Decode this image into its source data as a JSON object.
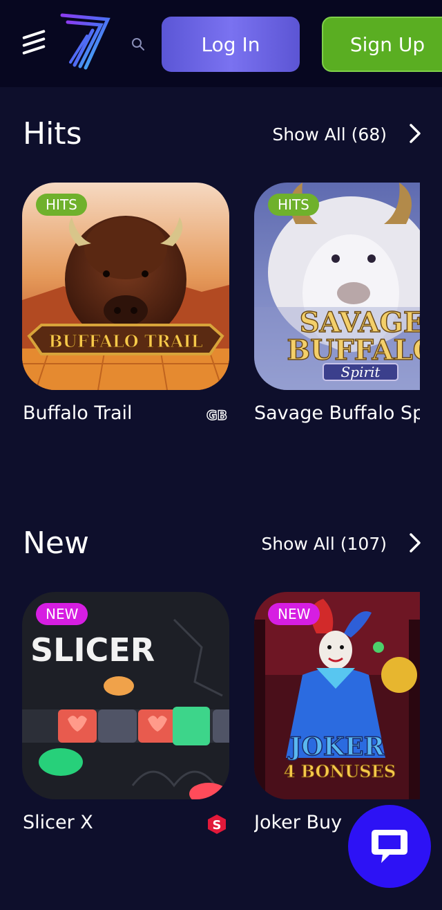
{
  "header": {
    "login_label": "Log In",
    "signup_label": "Sign Up",
    "icons": [
      "menu-icon",
      "brand-logo",
      "search-icon"
    ]
  },
  "sections": [
    {
      "title": "Hits",
      "show_all": "Show All (68)",
      "games": [
        {
          "title": "Buffalo Trail",
          "badge": "HITS",
          "art_text": "BUFFALO TRAIL",
          "provider_icon": "GB"
        },
        {
          "title": "Savage Buffalo Spir",
          "badge": "HITS",
          "art_text": [
            "SAVAGE",
            "BUFFALO",
            "Spirit"
          ]
        }
      ]
    },
    {
      "title": "New",
      "show_all": "Show All (107)",
      "games": [
        {
          "title": "Slicer X",
          "badge": "NEW",
          "art_text": "SLICER",
          "provider_icon": "S"
        },
        {
          "title": "Joker Buy Bo",
          "badge": "NEW",
          "art_text": [
            "JOKER",
            "4 BONUSES"
          ]
        }
      ]
    }
  ],
  "colors": {
    "background": "#0e0f2c",
    "header": "#070720",
    "login": "#6a63e6",
    "signup": "#5aae22",
    "badge_hits": "#6fb12c",
    "badge_new": "#d61ee2",
    "chat": "#2d12f5"
  }
}
